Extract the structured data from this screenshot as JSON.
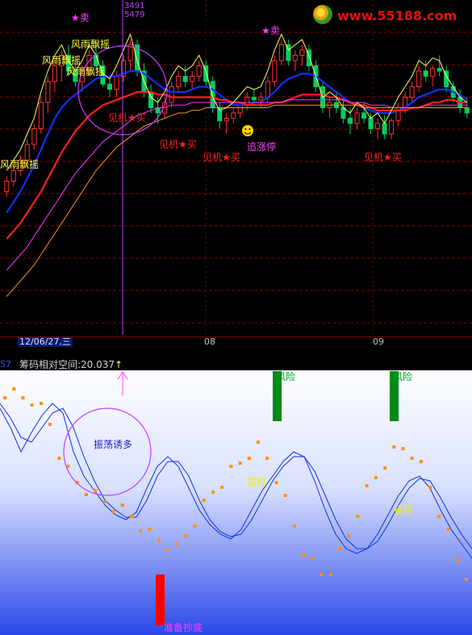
{
  "price_panel": {
    "crosshair_top": "3491",
    "crosshair_bottom": "5479",
    "annotations": [
      {
        "text": "★卖",
        "color": "#ff40ff"
      },
      {
        "text": "★卖",
        "color": "#ff40ff"
      },
      {
        "text": "风雨飘摇",
        "color": "#ffff40"
      },
      {
        "text": "风雨飘摇",
        "color": "#ffff40"
      },
      {
        "text": "风雨飘摇",
        "color": "#ffff40"
      },
      {
        "text": "风雨飘摇",
        "color": "#ffff40"
      },
      {
        "text": "见机★买",
        "color": "#ff2020"
      },
      {
        "text": "见机★买",
        "color": "#ff2020"
      },
      {
        "text": "见机★买",
        "color": "#ff2020"
      },
      {
        "text": "见机★买",
        "color": "#ff2020"
      },
      {
        "text": "追涨停",
        "color": "#ff40ff"
      }
    ],
    "colors": {
      "up": "#ff3030",
      "down": "#00d060",
      "ma_red": "#ff2020",
      "ma_blue": "#1030ff",
      "ma_magenta": "#ff30ff",
      "ma_orange": "#ff9020",
      "ma_yellow": "#ffff60",
      "grid": "#8a0000",
      "crosshair": "#c040ff"
    }
  },
  "time_axis": {
    "cursor_date": "12/06/27,三",
    "ticks": [
      "08",
      "09"
    ]
  },
  "logo": {
    "text": "www.55188.com"
  },
  "indicator_panel": {
    "index_text": "57",
    "title": "筹码相对空间:20.037",
    "arrow": "↑",
    "annotations": [
      {
        "text": "风险",
        "color": "#00a020"
      },
      {
        "text": "风险",
        "color": "#00a020"
      },
      {
        "text": "振荡诱多",
        "color": "#2020c0"
      },
      {
        "text": "猛拉",
        "color": "#f0f000"
      },
      {
        "text": "猛拉",
        "color": "#f0f000"
      },
      {
        "text": "准备抄底",
        "color": "#ff40ff"
      }
    ],
    "colors": {
      "line": "#1030e0",
      "dots": "#ff9010",
      "risk_bar": "#008a18",
      "bottom_bar": "#ff0000",
      "bg_top": "#ffffff",
      "bg_bottom": "#3050f0"
    }
  },
  "chart_data": [
    {
      "type": "line",
      "title": "",
      "candles": [
        [
          12.0,
          12.6,
          11.8,
          12.4
        ],
        [
          12.4,
          13.0,
          12.2,
          12.8
        ],
        [
          12.8,
          13.4,
          12.6,
          13.2
        ],
        [
          13.2,
          14.0,
          13.0,
          13.8
        ],
        [
          13.8,
          14.6,
          13.6,
          14.4
        ],
        [
          14.4,
          15.6,
          14.2,
          15.4
        ],
        [
          15.4,
          16.4,
          15.0,
          16.2
        ],
        [
          16.2,
          17.0,
          15.8,
          16.8
        ],
        [
          16.8,
          17.4,
          16.2,
          17.2
        ],
        [
          17.2,
          17.6,
          16.4,
          16.6
        ],
        [
          16.6,
          17.0,
          16.0,
          16.2
        ],
        [
          16.2,
          16.8,
          15.8,
          16.6
        ],
        [
          16.6,
          17.4,
          16.4,
          17.2
        ],
        [
          17.2,
          17.6,
          16.6,
          16.8
        ],
        [
          16.8,
          17.0,
          16.0,
          16.1
        ],
        [
          16.1,
          16.4,
          15.6,
          15.9
        ],
        [
          15.9,
          16.6,
          15.6,
          16.4
        ],
        [
          16.4,
          17.2,
          16.2,
          17.0
        ],
        [
          17.0,
          17.8,
          16.6,
          17.6
        ],
        [
          17.6,
          17.8,
          16.4,
          16.6
        ],
        [
          16.6,
          16.9,
          15.6,
          15.8
        ],
        [
          15.8,
          16.1,
          15.0,
          15.2
        ],
        [
          15.2,
          15.6,
          14.6,
          15.0
        ],
        [
          15.0,
          15.6,
          14.8,
          15.4
        ],
        [
          15.4,
          16.2,
          15.2,
          16.0
        ],
        [
          16.0,
          16.6,
          15.8,
          16.4
        ],
        [
          16.4,
          16.8,
          16.0,
          16.2
        ],
        [
          16.2,
          16.6,
          15.9,
          16.4
        ],
        [
          16.4,
          17.0,
          16.2,
          16.8
        ],
        [
          16.8,
          17.0,
          16.0,
          16.2
        ],
        [
          16.2,
          16.4,
          15.0,
          15.2
        ],
        [
          15.2,
          15.4,
          14.4,
          14.7
        ],
        [
          14.7,
          15.0,
          14.2,
          14.8
        ],
        [
          14.8,
          15.2,
          14.6,
          15.0
        ],
        [
          15.0,
          15.4,
          14.8,
          15.3
        ],
        [
          15.3,
          15.8,
          15.1,
          15.6
        ],
        [
          15.6,
          15.9,
          15.3,
          15.5
        ],
        [
          15.5,
          15.8,
          15.2,
          15.6
        ],
        [
          15.6,
          16.4,
          15.4,
          16.2
        ],
        [
          16.2,
          17.2,
          16.0,
          17.0
        ],
        [
          17.0,
          17.8,
          16.8,
          17.6
        ],
        [
          17.6,
          17.8,
          16.8,
          17.0
        ],
        [
          17.0,
          17.4,
          16.6,
          17.2
        ],
        [
          17.2,
          17.6,
          16.8,
          17.4
        ],
        [
          17.4,
          17.6,
          16.6,
          16.8
        ],
        [
          16.8,
          17.0,
          15.8,
          16.0
        ],
        [
          16.0,
          16.2,
          15.0,
          15.2
        ],
        [
          15.2,
          15.6,
          14.8,
          15.4
        ],
        [
          15.4,
          15.8,
          15.0,
          15.2
        ],
        [
          15.2,
          15.6,
          14.6,
          14.8
        ],
        [
          14.8,
          15.2,
          14.2,
          14.6
        ],
        [
          14.6,
          15.2,
          14.4,
          15.0
        ],
        [
          15.0,
          15.4,
          14.6,
          14.8
        ],
        [
          14.8,
          15.0,
          14.2,
          14.4
        ],
        [
          14.4,
          14.8,
          14.0,
          14.6
        ],
        [
          14.6,
          14.9,
          14.0,
          14.2
        ],
        [
          14.2,
          14.8,
          14.0,
          14.7
        ],
        [
          14.7,
          15.4,
          14.5,
          15.2
        ],
        [
          15.2,
          15.8,
          15.0,
          15.6
        ],
        [
          15.6,
          16.2,
          15.4,
          16.0
        ],
        [
          16.0,
          16.8,
          15.8,
          16.6
        ],
        [
          16.6,
          17.0,
          16.2,
          16.4
        ],
        [
          16.4,
          16.8,
          16.0,
          16.7
        ],
        [
          16.7,
          17.2,
          16.4,
          16.6
        ],
        [
          16.6,
          16.8,
          15.8,
          16.0
        ],
        [
          16.0,
          16.2,
          15.4,
          15.6
        ],
        [
          15.6,
          15.9,
          15.0,
          15.2
        ],
        [
          15.2,
          15.6,
          14.8,
          15.0
        ]
      ],
      "series": [
        {
          "values": [
            11.2,
            11.6,
            12.0,
            12.5,
            13.0,
            13.6,
            14.2,
            14.8,
            15.2,
            15.5,
            15.7,
            15.9,
            16.1,
            16.3,
            16.4,
            16.4,
            16.4,
            16.5,
            16.6,
            16.6,
            16.5,
            16.3,
            16.1,
            15.9,
            15.8,
            15.8,
            15.8,
            15.9,
            16.0,
            16.0,
            15.9,
            15.7,
            15.5,
            15.3,
            15.3,
            15.3,
            15.4,
            15.4,
            15.6,
            15.8,
            16.1,
            16.3,
            16.4,
            16.5,
            16.5,
            16.4,
            16.2,
            16.0,
            15.8,
            15.6,
            15.4,
            15.3,
            15.2,
            15.1,
            15.0,
            15.0,
            15.0,
            15.1,
            15.2,
            15.4,
            15.6,
            15.7,
            15.8,
            15.9,
            15.9,
            15.8,
            15.7,
            15.5
          ]
        },
        {
          "values": [
            10.2,
            10.5,
            10.8,
            11.2,
            11.6,
            12.0,
            12.5,
            13.0,
            13.5,
            13.9,
            14.3,
            14.6,
            14.9,
            15.1,
            15.3,
            15.4,
            15.5,
            15.6,
            15.7,
            15.8,
            15.8,
            15.8,
            15.7,
            15.7,
            15.6,
            15.6,
            15.6,
            15.6,
            15.6,
            15.6,
            15.6,
            15.5,
            15.5,
            15.4,
            15.4,
            15.3,
            15.3,
            15.3,
            15.3,
            15.4,
            15.4,
            15.5,
            15.6,
            15.7,
            15.7,
            15.7,
            15.7,
            15.6,
            15.6,
            15.5,
            15.4,
            15.3,
            15.3,
            15.2,
            15.1,
            15.1,
            15.1,
            15.1,
            15.1,
            15.2,
            15.2,
            15.3,
            15.4,
            15.4,
            15.5,
            15.5,
            15.4,
            15.4
          ]
        },
        {
          "values": [
            9.0,
            9.3,
            9.6,
            9.9,
            10.3,
            10.7,
            11.1,
            11.5,
            11.9,
            12.3,
            12.7,
            13.0,
            13.3,
            13.6,
            13.9,
            14.1,
            14.3,
            14.5,
            14.7,
            14.9,
            15.0,
            15.1,
            15.2,
            15.2,
            15.3,
            15.3,
            15.3,
            15.4,
            15.4,
            15.4,
            15.4,
            15.4,
            15.4,
            15.4,
            15.4,
            15.4,
            15.4,
            15.4,
            15.4,
            15.4,
            15.4,
            15.5,
            15.5,
            15.5,
            15.5,
            15.5,
            15.5,
            15.5,
            15.5,
            15.5,
            15.4,
            15.4,
            15.4,
            15.3,
            15.3,
            15.3,
            15.2,
            15.2,
            15.2,
            15.2,
            15.2,
            15.3,
            15.3,
            15.3,
            15.3,
            15.3,
            15.3,
            15.3
          ]
        },
        {
          "values": [
            8.0,
            8.3,
            8.6,
            8.9,
            9.2,
            9.6,
            10.0,
            10.4,
            10.8,
            11.2,
            11.6,
            12.0,
            12.4,
            12.8,
            13.1,
            13.4,
            13.7,
            13.9,
            14.1,
            14.3,
            14.5,
            14.6,
            14.7,
            14.8,
            14.9,
            15.0,
            15.0,
            15.1,
            15.1,
            15.2,
            15.2,
            15.2,
            15.2,
            15.2,
            15.2,
            15.2,
            15.2,
            15.2,
            15.2,
            15.3,
            15.3,
            15.3,
            15.3,
            15.3,
            15.3,
            15.3,
            15.3,
            15.3,
            15.3,
            15.3,
            15.3,
            15.3,
            15.2,
            15.2,
            15.2,
            15.2,
            15.2,
            15.2,
            15.2,
            15.2,
            15.2,
            15.2,
            15.2,
            15.2,
            15.2,
            15.2,
            15.2,
            15.2
          ]
        }
      ],
      "xlabel": "",
      "ylabel": ""
    },
    {
      "type": "line",
      "title": "筹码相对空间:20.037",
      "series": [
        {
          "values": [
            88,
            80,
            70,
            78,
            85,
            90,
            86,
            70,
            60,
            54,
            48,
            44,
            42,
            45,
            55,
            64,
            68,
            64,
            55,
            46,
            40,
            36,
            34,
            38,
            46,
            54,
            60,
            66,
            70,
            68,
            58,
            46,
            36,
            30,
            28,
            30,
            36,
            44,
            52,
            58,
            60,
            55,
            46,
            38,
            32,
            26
          ]
        },
        {
          "values": [
            90,
            84,
            76,
            74,
            80,
            86,
            88,
            80,
            68,
            58,
            50,
            46,
            43,
            43,
            50,
            60,
            66,
            66,
            60,
            50,
            42,
            37,
            35,
            36,
            42,
            50,
            58,
            64,
            68,
            68,
            62,
            52,
            42,
            34,
            30,
            30,
            33,
            40,
            48,
            55,
            59,
            58,
            51,
            43,
            36,
            30
          ]
        }
      ],
      "dots": [
        95,
        94,
        93,
        92,
        88,
        82,
        70,
        62,
        58,
        55,
        52,
        50,
        48,
        46,
        44,
        40,
        36,
        34,
        32,
        30,
        36,
        42,
        48,
        54,
        58,
        62,
        66,
        70,
        72,
        68,
        60,
        50,
        40,
        30,
        24,
        20,
        22,
        28,
        36,
        46,
        54,
        60,
        66,
        70,
        72,
        70,
        64,
        56,
        46,
        36,
        26,
        20
      ],
      "ylim": [
        0,
        100
      ]
    }
  ]
}
